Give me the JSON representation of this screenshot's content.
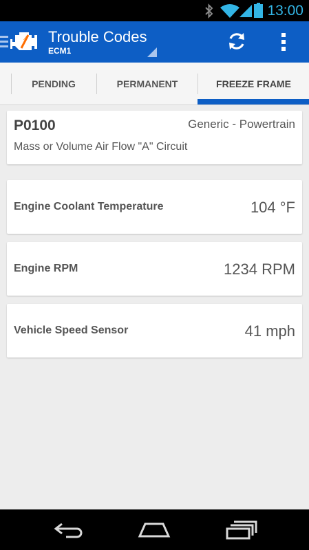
{
  "status_bar": {
    "time": "13:00",
    "icons": [
      "bluetooth-icon",
      "wifi-icon",
      "signal-icon",
      "battery-icon"
    ],
    "accent": "#33b5e5"
  },
  "action_bar": {
    "title": "Trouble Codes",
    "subtitle": "ECM1",
    "background": "#0d5ec5",
    "icons": [
      "app-logo-icon",
      "refresh-icon",
      "overflow-menu-icon"
    ]
  },
  "tabs": [
    {
      "label": "PENDING",
      "selected": false
    },
    {
      "label": "PERMANENT",
      "selected": false
    },
    {
      "label": "FREEZE FRAME",
      "selected": true
    }
  ],
  "trouble_code": {
    "code": "P0100",
    "category": "Generic - Powertrain",
    "description": "Mass or Volume Air Flow \"A\" Circuit"
  },
  "freeze_frame": [
    {
      "label": "Engine Coolant Temperature",
      "value": "104 °F"
    },
    {
      "label": "Engine RPM",
      "value": "1234 RPM"
    },
    {
      "label": "Vehicle Speed Sensor",
      "value": "41 mph"
    }
  ],
  "nav_bar": {
    "icons": [
      "back-icon",
      "home-icon",
      "recent-apps-icon"
    ]
  }
}
